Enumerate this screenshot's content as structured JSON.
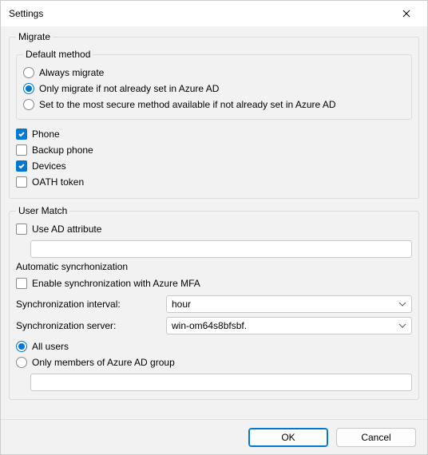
{
  "window": {
    "title": "Settings"
  },
  "migrate": {
    "legend": "Migrate",
    "default_method": {
      "legend": "Default method",
      "options": {
        "always": "Always migrate",
        "only_if_not_set": "Only migrate if not already set in Azure AD",
        "most_secure": "Set to the most secure method available if not already set in Azure AD"
      },
      "selected": "only_if_not_set"
    },
    "checks": {
      "phone": {
        "label": "Phone",
        "checked": true
      },
      "backup_phone": {
        "label": "Backup phone",
        "checked": false
      },
      "devices": {
        "label": "Devices",
        "checked": true
      },
      "oath_token": {
        "label": "OATH token",
        "checked": false
      }
    }
  },
  "user_match": {
    "legend": "User Match",
    "use_ad_attribute": {
      "label": "Use AD attribute",
      "checked": false
    },
    "attribute_value": ""
  },
  "sync": {
    "title": "Automatic syncrhonization",
    "enable": {
      "label": "Enable synchronization with Azure MFA",
      "checked": false
    },
    "interval": {
      "label": "Synchronization interval:",
      "value": "hour"
    },
    "server": {
      "label": "Synchronization server:",
      "value": "win-om64s8bfsbf."
    },
    "scope": {
      "all_users": "All users",
      "only_group": "Only members of Azure AD group",
      "selected": "all_users",
      "group_value": ""
    }
  },
  "footer": {
    "ok": "OK",
    "cancel": "Cancel"
  }
}
